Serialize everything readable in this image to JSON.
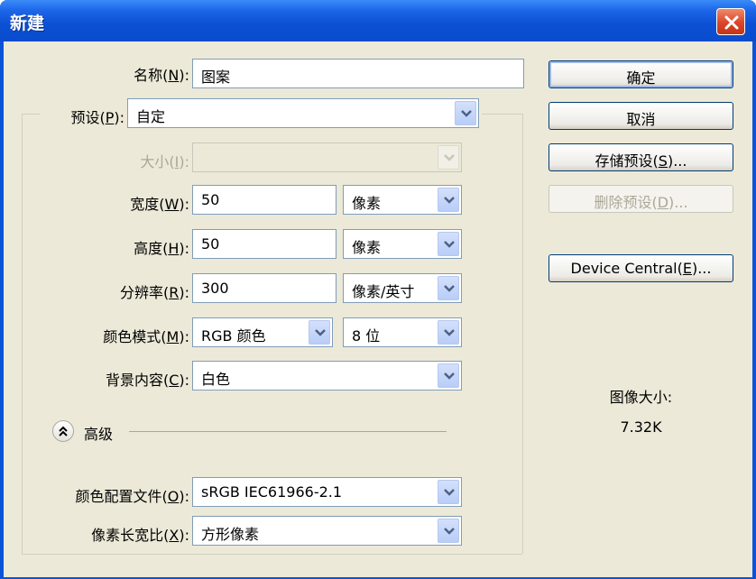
{
  "window": {
    "title": "新建"
  },
  "form": {
    "name_label_pre": "名称(",
    "name_label_key": "N",
    "name_label_post": "):",
    "name_value": "图案",
    "preset_label_pre": "预设(",
    "preset_label_key": "P",
    "preset_label_post": "):",
    "preset_value": "自定",
    "size_label_pre": "大小(",
    "size_label_key": "I",
    "size_label_post": "):",
    "width_label_pre": "宽度(",
    "width_label_key": "W",
    "width_label_post": "):",
    "width_value": "50",
    "width_unit": "像素",
    "height_label_pre": "高度(",
    "height_label_key": "H",
    "height_label_post": "):",
    "height_value": "50",
    "height_unit": "像素",
    "res_label_pre": "分辨率(",
    "res_label_key": "R",
    "res_label_post": "):",
    "res_value": "300",
    "res_unit": "像素/英寸",
    "mode_label_pre": "颜色模式(",
    "mode_label_key": "M",
    "mode_label_post": "):",
    "mode_value": "RGB 颜色",
    "mode_depth": "8 位",
    "bg_label_pre": "背景内容(",
    "bg_label_key": "C",
    "bg_label_post": "):",
    "bg_value": "白色",
    "advanced_label": "高级",
    "profile_label_pre": "颜色配置文件(",
    "profile_label_key": "O",
    "profile_label_post": "):",
    "profile_value": "sRGB IEC61966-2.1",
    "aspect_label_pre": "像素长宽比(",
    "aspect_label_key": "X",
    "aspect_label_post": "):",
    "aspect_value": "方形像素"
  },
  "buttons": {
    "ok": "确定",
    "cancel": "取消",
    "save_pre": "存储预设(",
    "save_key": "S",
    "save_post": ")...",
    "delete_pre": "删除预设(",
    "delete_key": "D",
    "delete_post": ")...",
    "device_pre": "Device Central(",
    "device_key": "E",
    "device_post": ")..."
  },
  "info": {
    "image_size_label": "图像大小:",
    "image_size_value": "7.32K"
  },
  "icons": [
    "close-icon",
    "dropdown-arrow-icon",
    "collapse-chevron-icon"
  ]
}
